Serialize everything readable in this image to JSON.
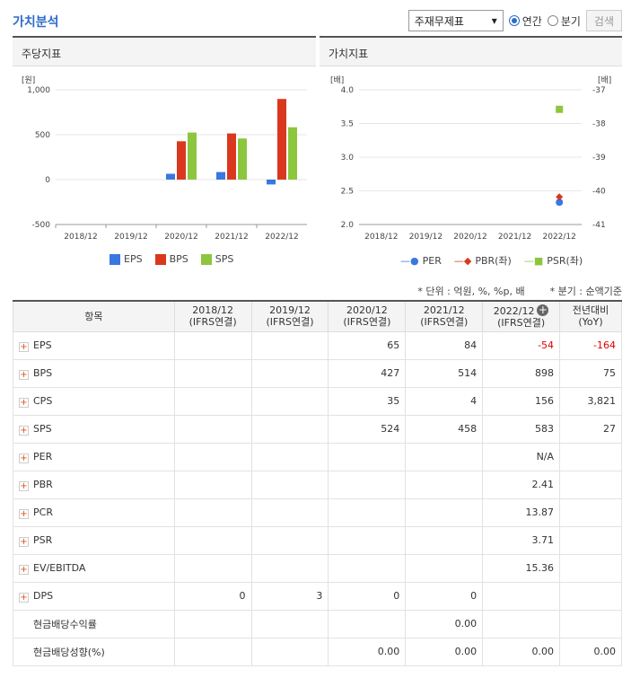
{
  "page_title": "가치분석",
  "controls": {
    "select_value": "주재무제표",
    "radio_annual": "연간",
    "radio_quarter": "분기",
    "search_button": "검색"
  },
  "left_chart": {
    "panel_title": "주당지표",
    "unit": "[원]",
    "y_ticks": [
      "1,000",
      "500",
      "0",
      "-500"
    ],
    "x_ticks": [
      "2018/12",
      "2019/12",
      "2020/12",
      "2021/12",
      "2022/12"
    ],
    "legend": [
      "EPS",
      "BPS",
      "SPS"
    ],
    "colors": {
      "EPS": "#3a77e0",
      "BPS": "#d9381e",
      "SPS": "#8cc63e"
    }
  },
  "right_chart": {
    "panel_title": "가치지표",
    "unit_left": "[배]",
    "unit_right": "[배]",
    "y_ticks_left": [
      "4.0",
      "3.5",
      "3.0",
      "2.5",
      "2.0"
    ],
    "y_ticks_right": [
      "-37",
      "-38",
      "-39",
      "-40",
      "-41"
    ],
    "x_ticks": [
      "2018/12",
      "2019/12",
      "2020/12",
      "2021/12",
      "2022/12"
    ],
    "legend": [
      "PER",
      "PBR(좌)",
      "PSR(좌)"
    ],
    "colors": {
      "PER": "#3a77e0",
      "PBR": "#d9381e",
      "PSR": "#8cc63e"
    }
  },
  "chart_data": [
    {
      "type": "bar",
      "title": "주당지표",
      "ylabel": "[원]",
      "ylim": [
        -500,
        1000
      ],
      "categories": [
        "2018/12",
        "2019/12",
        "2020/12",
        "2021/12",
        "2022/12"
      ],
      "series": [
        {
          "name": "EPS",
          "values": [
            null,
            null,
            65,
            84,
            -54
          ]
        },
        {
          "name": "BPS",
          "values": [
            null,
            null,
            427,
            514,
            898
          ]
        },
        {
          "name": "SPS",
          "values": [
            null,
            null,
            524,
            458,
            583
          ]
        }
      ]
    },
    {
      "type": "scatter",
      "title": "가치지표",
      "ylabel": "[배]",
      "ylim": [
        2.0,
        4.0
      ],
      "y2lim": [
        -41,
        -37
      ],
      "categories": [
        "2018/12",
        "2019/12",
        "2020/12",
        "2021/12",
        "2022/12"
      ],
      "series": [
        {
          "name": "PER",
          "values": [
            null,
            null,
            null,
            null,
            2.33
          ]
        },
        {
          "name": "PBR(좌)",
          "values": [
            null,
            null,
            null,
            null,
            2.41
          ]
        },
        {
          "name": "PSR(좌)",
          "values": [
            null,
            null,
            null,
            null,
            3.71
          ]
        }
      ]
    }
  ],
  "notes": {
    "unit_note": "* 단위 : 억원, %, %p, 배",
    "quarter_note": "* 분기 : 순액기준"
  },
  "table": {
    "header_item": "항목",
    "columns": [
      {
        "year": "2018/12",
        "basis": "(IFRS연결)"
      },
      {
        "year": "2019/12",
        "basis": "(IFRS연결)"
      },
      {
        "year": "2020/12",
        "basis": "(IFRS연결)"
      },
      {
        "year": "2021/12",
        "basis": "(IFRS연결)"
      },
      {
        "year": "2022/12",
        "basis": "(IFRS연결)"
      }
    ],
    "yoy_header": "전년대비",
    "yoy_sub": "(YoY)",
    "rows": [
      {
        "label": "EPS",
        "expand": true,
        "v": [
          "",
          "",
          "65",
          "84",
          "-54",
          "-164"
        ]
      },
      {
        "label": "BPS",
        "expand": true,
        "v": [
          "",
          "",
          "427",
          "514",
          "898",
          "75"
        ]
      },
      {
        "label": "CPS",
        "expand": true,
        "v": [
          "",
          "",
          "35",
          "4",
          "156",
          "3,821"
        ]
      },
      {
        "label": "SPS",
        "expand": true,
        "v": [
          "",
          "",
          "524",
          "458",
          "583",
          "27"
        ]
      },
      {
        "label": "PER",
        "expand": true,
        "v": [
          "",
          "",
          "",
          "",
          "N/A",
          ""
        ]
      },
      {
        "label": "PBR",
        "expand": true,
        "v": [
          "",
          "",
          "",
          "",
          "2.41",
          ""
        ]
      },
      {
        "label": "PCR",
        "expand": true,
        "v": [
          "",
          "",
          "",
          "",
          "13.87",
          ""
        ]
      },
      {
        "label": "PSR",
        "expand": true,
        "v": [
          "",
          "",
          "",
          "",
          "3.71",
          ""
        ]
      },
      {
        "label": "EV/EBITDA",
        "expand": true,
        "v": [
          "",
          "",
          "",
          "",
          "15.36",
          ""
        ]
      },
      {
        "label": "DPS",
        "expand": true,
        "v": [
          "0",
          "3",
          "0",
          "0",
          "",
          ""
        ]
      },
      {
        "label": "현금배당수익률",
        "expand": false,
        "v": [
          "",
          "",
          "",
          "0.00",
          "",
          ""
        ]
      },
      {
        "label": "현금배당성향(%)",
        "expand": false,
        "v": [
          "",
          "",
          "0.00",
          "0.00",
          "0.00",
          "0.00"
        ]
      }
    ]
  }
}
